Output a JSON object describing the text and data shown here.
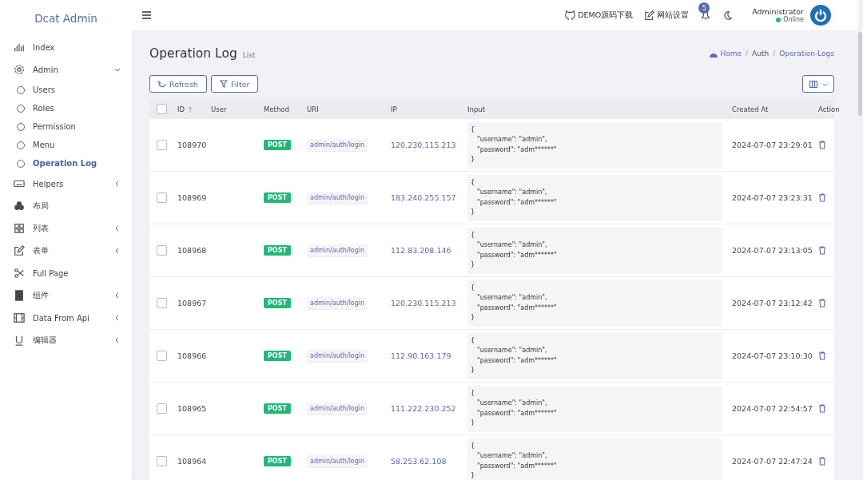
{
  "brand": "Dcat Admin",
  "sidebar": {
    "items": [
      {
        "label": "Index"
      },
      {
        "label": "Admin",
        "expanded": true,
        "children": [
          {
            "label": "Users",
            "selected": false
          },
          {
            "label": "Roles",
            "selected": false
          },
          {
            "label": "Permission",
            "selected": false
          },
          {
            "label": "Menu",
            "selected": false
          },
          {
            "label": "Operation Log",
            "selected": true
          }
        ]
      },
      {
        "label": "Helpers",
        "expanded": false
      },
      {
        "label": "布局"
      },
      {
        "label": "列表",
        "expanded": false
      },
      {
        "label": "表单",
        "expanded": false
      },
      {
        "label": "Full Page"
      },
      {
        "label": "组件",
        "expanded": false
      },
      {
        "label": "Data From Api",
        "expanded": false
      },
      {
        "label": "编辑器",
        "expanded": false
      }
    ]
  },
  "navbar": {
    "links": [
      "DEMO源码下载",
      "网站设置"
    ],
    "notifications": "5",
    "user": {
      "name": "Administrator",
      "status": "Online"
    }
  },
  "page": {
    "title": "Operation Log",
    "subtitle": "List",
    "breadcrumb": [
      "Home",
      "Auth",
      "Operation-Logs"
    ],
    "breadcrumb_separator": "/"
  },
  "toolbar": {
    "buttons": [
      "Refresh",
      "Filter"
    ]
  },
  "table": {
    "select_all_checked": false,
    "columns": [
      "ID",
      "User",
      "Method",
      "URI",
      "IP",
      "Input",
      "Created At",
      "Action"
    ],
    "rows": [
      {
        "checked": false,
        "id": "108970",
        "method": "POST",
        "uri": "admin/auth/login",
        "ip": "120.230.115.213",
        "input": [
          "{",
          "\"username\": \"admin\",",
          "\"password\": \"adm******\"",
          "}"
        ],
        "created_at": "2024-07-07 23:29:01"
      },
      {
        "checked": false,
        "id": "108969",
        "method": "POST",
        "uri": "admin/auth/login",
        "ip": "183.240.255.157",
        "input": [
          "{",
          "\"username\": \"admin\",",
          "\"password\": \"adm******\"",
          "}"
        ],
        "created_at": "2024-07-07 23:23:31"
      },
      {
        "checked": false,
        "id": "108968",
        "method": "POST",
        "uri": "admin/auth/login",
        "ip": "112.83.208.146",
        "input": [
          "{",
          "\"username\": \"admin\",",
          "\"password\": \"adm******\"",
          "}"
        ],
        "created_at": "2024-07-07 23:13:05"
      },
      {
        "checked": false,
        "id": "108967",
        "method": "POST",
        "uri": "admin/auth/login",
        "ip": "120.230.115.213",
        "input": [
          "{",
          "\"username\": \"admin\",",
          "\"password\": \"adm******\"",
          "}"
        ],
        "created_at": "2024-07-07 23:12:42"
      },
      {
        "checked": false,
        "id": "108966",
        "method": "POST",
        "uri": "admin/auth/login",
        "ip": "112.90.163.179",
        "input": [
          "{",
          "\"username\": \"admin\",",
          "\"password\": \"adm******\"",
          "}"
        ],
        "created_at": "2024-07-07 23:10:30"
      },
      {
        "checked": false,
        "id": "108965",
        "method": "POST",
        "uri": "admin/auth/login",
        "ip": "111.222.230.252",
        "input": [
          "{",
          "\"username\": \"admin\",",
          "\"password\": \"adm******\"",
          "}"
        ],
        "created_at": "2024-07-07 22:54:57"
      },
      {
        "checked": false,
        "id": "108964",
        "method": "POST",
        "uri": "admin/auth/login",
        "ip": "58.253.62.108",
        "input": [
          "{",
          "\"username\": \"admin\",",
          "\"password\": \"adm******\"",
          "}"
        ],
        "created_at": "2024-07-07 22:47:24"
      }
    ]
  }
}
